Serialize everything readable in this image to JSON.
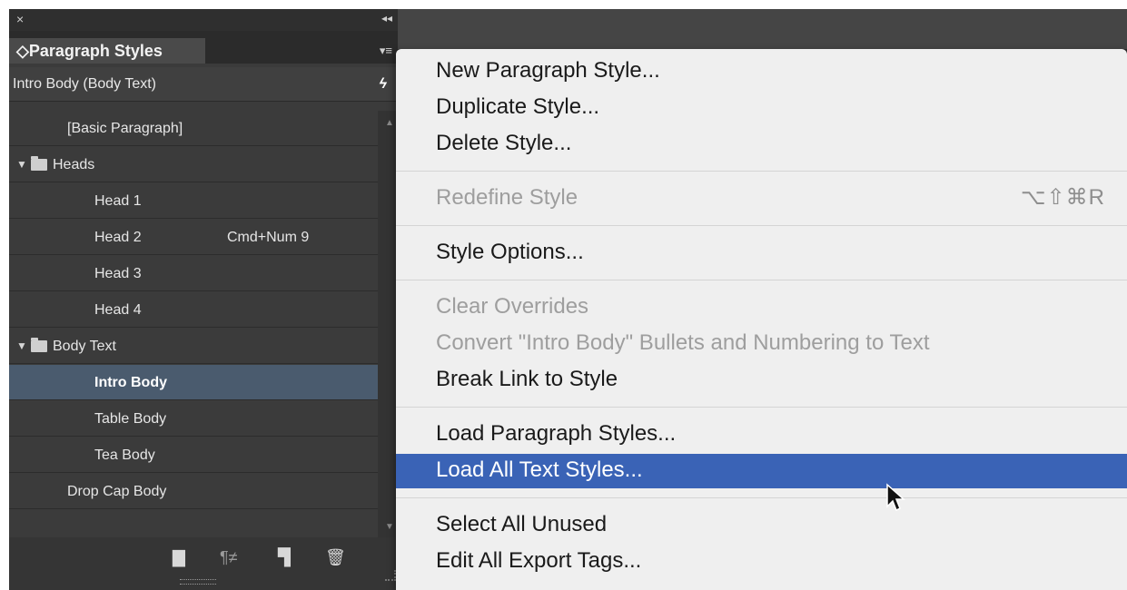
{
  "panel": {
    "close_glyph": "×",
    "collapse_glyph": "◂◂",
    "tab_title": "◇Paragraph Styles",
    "menu_button_glyph": "▾≡",
    "current_style": "Intro Body (Body Text)",
    "quick_apply_glyph": "ϟ",
    "scroll_up_glyph": "▲",
    "scroll_down_glyph": "▼",
    "styles": [
      {
        "label": "[Basic Paragraph]",
        "indent": 1,
        "group": false,
        "selected": false,
        "shortcut": ""
      },
      {
        "label": "Heads",
        "indent": 0,
        "group": true,
        "selected": false,
        "shortcut": ""
      },
      {
        "label": "Head 1",
        "indent": 2,
        "group": false,
        "selected": false,
        "shortcut": ""
      },
      {
        "label": "Head 2",
        "indent": 2,
        "group": false,
        "selected": false,
        "shortcut": "Cmd+Num 9"
      },
      {
        "label": "Head 3",
        "indent": 2,
        "group": false,
        "selected": false,
        "shortcut": ""
      },
      {
        "label": "Head 4",
        "indent": 2,
        "group": false,
        "selected": false,
        "shortcut": ""
      },
      {
        "label": "Body Text",
        "indent": 0,
        "group": true,
        "selected": false,
        "shortcut": ""
      },
      {
        "label": "Intro Body",
        "indent": 2,
        "group": false,
        "selected": true,
        "shortcut": ""
      },
      {
        "label": "Table Body",
        "indent": 2,
        "group": false,
        "selected": false,
        "shortcut": ""
      },
      {
        "label": "Tea Body",
        "indent": 2,
        "group": false,
        "selected": false,
        "shortcut": ""
      },
      {
        "label": "Drop Cap Body",
        "indent": 1,
        "group": false,
        "selected": false,
        "shortcut": ""
      }
    ],
    "footer_icons": [
      {
        "name": "new-style-group-icon",
        "glyph": "▇"
      },
      {
        "name": "clear-overrides-icon",
        "glyph": "¶≠"
      },
      {
        "name": "create-new-style-icon",
        "glyph": "▜"
      },
      {
        "name": "delete-style-icon",
        "glyph": "🗑"
      }
    ]
  },
  "menu": {
    "items": [
      {
        "label": "New Paragraph Style...",
        "disabled": false,
        "highlighted": false,
        "shortcut": ""
      },
      {
        "label": "Duplicate Style...",
        "disabled": false,
        "highlighted": false,
        "shortcut": ""
      },
      {
        "label": "Delete Style...",
        "disabled": false,
        "highlighted": false,
        "shortcut": ""
      },
      {
        "label": "Redefine Style",
        "disabled": true,
        "highlighted": false,
        "shortcut": "⌥⇧⌘R"
      },
      {
        "label": "Style Options...",
        "disabled": false,
        "highlighted": false,
        "shortcut": ""
      },
      {
        "label": "Clear Overrides",
        "disabled": true,
        "highlighted": false,
        "shortcut": ""
      },
      {
        "label": "Convert \"Intro Body\" Bullets and Numbering to Text",
        "disabled": true,
        "highlighted": false,
        "shortcut": ""
      },
      {
        "label": "Break Link to Style",
        "disabled": false,
        "highlighted": false,
        "shortcut": ""
      },
      {
        "label": "Load Paragraph Styles...",
        "disabled": false,
        "highlighted": false,
        "shortcut": ""
      },
      {
        "label": "Load All Text Styles...",
        "disabled": false,
        "highlighted": true,
        "shortcut": ""
      },
      {
        "label": "Select All Unused",
        "disabled": false,
        "highlighted": false,
        "shortcut": ""
      },
      {
        "label": "Edit All Export Tags...",
        "disabled": false,
        "highlighted": false,
        "shortcut": ""
      }
    ]
  },
  "colors": {
    "panel_bg": "#3b3b3b",
    "selected_row": "#4a5b6e",
    "menu_bg": "#efefef",
    "menu_highlight": "#3a63b6",
    "disabled_text": "#9e9e9e"
  }
}
